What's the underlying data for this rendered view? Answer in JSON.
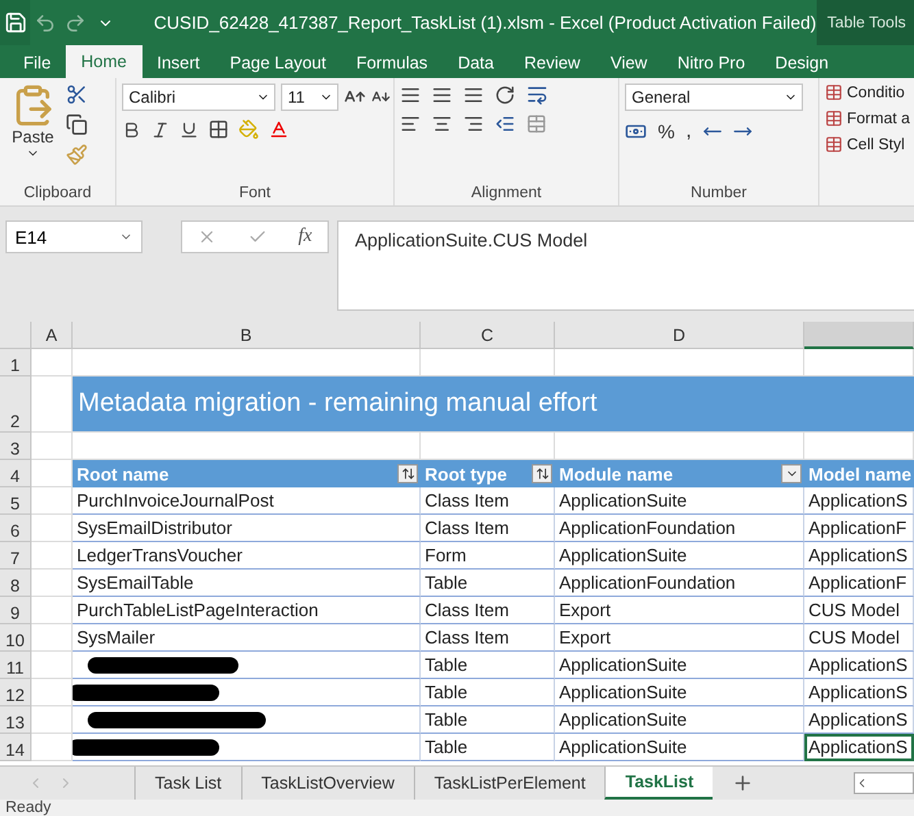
{
  "window": {
    "title": "CUSID_62428_417387_Report_TaskList (1).xlsm - Excel (Product Activation Failed)",
    "context_label": "Table Tools"
  },
  "ribbon_tabs": [
    {
      "label": "File",
      "selected": false
    },
    {
      "label": "Home",
      "selected": true
    },
    {
      "label": "Insert",
      "selected": false
    },
    {
      "label": "Page Layout",
      "selected": false
    },
    {
      "label": "Formulas",
      "selected": false
    },
    {
      "label": "Data",
      "selected": false
    },
    {
      "label": "Review",
      "selected": false
    },
    {
      "label": "View",
      "selected": false
    },
    {
      "label": "Nitro Pro",
      "selected": false
    },
    {
      "label": "Design",
      "selected": false
    }
  ],
  "ribbon": {
    "clipboard": {
      "paste_label": "Paste",
      "group_label": "Clipboard"
    },
    "font": {
      "name": "Calibri",
      "size": "11",
      "group_label": "Font"
    },
    "alignment": {
      "group_label": "Alignment"
    },
    "number": {
      "format": "General",
      "percent": "%",
      "comma": ",",
      "group_label": "Number"
    },
    "styles": [
      "Conditio",
      "Format a",
      "Cell Styl"
    ]
  },
  "formula_bar": {
    "name_box": "E14",
    "fx": "fx",
    "formula": "ApplicationSuite.CUS Model"
  },
  "columns": [
    {
      "label": "A",
      "selected": false
    },
    {
      "label": "B",
      "selected": false
    },
    {
      "label": "C",
      "selected": false
    },
    {
      "label": "D",
      "selected": false
    }
  ],
  "row_numbers": [
    "1",
    "2",
    "3",
    "4",
    "5",
    "6",
    "7",
    "8",
    "9",
    "10",
    "11",
    "12",
    "13",
    "14"
  ],
  "sheet": {
    "title": "Metadata migration - remaining manual effort",
    "headers": [
      {
        "label": "Root name",
        "filter_button": true,
        "sorted": true
      },
      {
        "label": "Root type",
        "filter_button": true,
        "sorted": true
      },
      {
        "label": "Module name",
        "filter_button": true,
        "sorted": false
      },
      {
        "label": "Model name",
        "filter_button": false
      }
    ],
    "rows": [
      {
        "root_name": "PurchInvoiceJournalPost",
        "root_type": "Class Item",
        "module": "ApplicationSuite",
        "model": "ApplicationS",
        "redacted": false,
        "selected": false
      },
      {
        "root_name": "SysEmailDistributor",
        "root_type": "Class Item",
        "module": "ApplicationFoundation",
        "model": "ApplicationF",
        "redacted": false,
        "selected": false
      },
      {
        "root_name": "LedgerTransVoucher",
        "root_type": "Form",
        "module": "ApplicationSuite",
        "model": "ApplicationS",
        "redacted": false,
        "selected": false
      },
      {
        "root_name": "SysEmailTable",
        "root_type": "Table",
        "module": "ApplicationFoundation",
        "model": "ApplicationF",
        "redacted": false,
        "selected": false
      },
      {
        "root_name": "PurchTableListPageInteraction",
        "root_type": "Class Item",
        "module": "Export",
        "model": "CUS Model",
        "redacted": false,
        "selected": false
      },
      {
        "root_name": "SysMailer",
        "root_type": "Class Item",
        "module": "Export",
        "model": "CUS Model",
        "redacted": false,
        "selected": false
      },
      {
        "root_type": "Table",
        "module": "ApplicationSuite",
        "model": "ApplicationS",
        "redacted": true,
        "selected": false
      },
      {
        "root_type": "Table",
        "module": "ApplicationSuite",
        "model": "ApplicationS",
        "redacted": true,
        "selected": false
      },
      {
        "root_type": "Table",
        "module": "ApplicationSuite",
        "model": "ApplicationS",
        "redacted": true,
        "selected": false
      },
      {
        "root_type": "Table",
        "module": "ApplicationSuite",
        "model": "ApplicationS",
        "redacted": true,
        "selected": true
      }
    ]
  },
  "sheet_tabs": [
    {
      "label": "Task List",
      "selected": false
    },
    {
      "label": "TaskListOverview",
      "selected": false
    },
    {
      "label": "TaskListPerElement",
      "selected": false
    },
    {
      "label": "TaskList",
      "selected": true
    }
  ],
  "status_bar": {
    "text": "Ready"
  }
}
